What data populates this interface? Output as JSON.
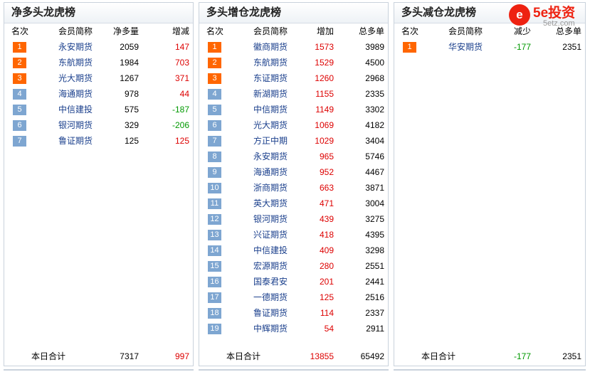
{
  "panel1": {
    "title": "净多头龙虎榜",
    "headers": [
      "名次",
      "会员简称",
      "净多量",
      "增减"
    ],
    "rows": [
      {
        "rank": "1",
        "name": "永安期货",
        "v1": "2059",
        "v2": "147",
        "v2_color": "red"
      },
      {
        "rank": "2",
        "name": "东航期货",
        "v1": "1984",
        "v2": "703",
        "v2_color": "red"
      },
      {
        "rank": "3",
        "name": "光大期货",
        "v1": "1267",
        "v2": "371",
        "v2_color": "red"
      },
      {
        "rank": "4",
        "name": "海通期货",
        "v1": "978",
        "v2": "44",
        "v2_color": "red"
      },
      {
        "rank": "5",
        "name": "中信建投",
        "v1": "575",
        "v2": "-187",
        "v2_color": "green"
      },
      {
        "rank": "6",
        "name": "银河期货",
        "v1": "329",
        "v2": "-206",
        "v2_color": "green"
      },
      {
        "rank": "7",
        "name": "鲁证期货",
        "v1": "125",
        "v2": "125",
        "v2_color": "red"
      }
    ],
    "footer": {
      "label": "本日合计",
      "v1": "7317",
      "v2": "997",
      "v2_color": "red"
    }
  },
  "panel2": {
    "title": "多头增仓龙虎榜",
    "headers": [
      "名次",
      "会员简称",
      "增加",
      "总多单"
    ],
    "rows": [
      {
        "rank": "1",
        "name": "徽商期货",
        "v1": "1573",
        "v2": "3989"
      },
      {
        "rank": "2",
        "name": "东航期货",
        "v1": "1529",
        "v2": "4500"
      },
      {
        "rank": "3",
        "name": "东证期货",
        "v1": "1260",
        "v2": "2968"
      },
      {
        "rank": "4",
        "name": "新湖期货",
        "v1": "1155",
        "v2": "2335"
      },
      {
        "rank": "5",
        "name": "中信期货",
        "v1": "1149",
        "v2": "3302"
      },
      {
        "rank": "6",
        "name": "光大期货",
        "v1": "1069",
        "v2": "4182"
      },
      {
        "rank": "7",
        "name": "方正中期",
        "v1": "1029",
        "v2": "3404"
      },
      {
        "rank": "8",
        "name": "永安期货",
        "v1": "965",
        "v2": "5746"
      },
      {
        "rank": "9",
        "name": "海通期货",
        "v1": "952",
        "v2": "4467"
      },
      {
        "rank": "10",
        "name": "浙商期货",
        "v1": "663",
        "v2": "3871"
      },
      {
        "rank": "11",
        "name": "英大期货",
        "v1": "471",
        "v2": "3004"
      },
      {
        "rank": "12",
        "name": "银河期货",
        "v1": "439",
        "v2": "3275"
      },
      {
        "rank": "13",
        "name": "兴证期货",
        "v1": "418",
        "v2": "4395"
      },
      {
        "rank": "14",
        "name": "中信建投",
        "v1": "409",
        "v2": "3298"
      },
      {
        "rank": "15",
        "name": "宏源期货",
        "v1": "280",
        "v2": "2551"
      },
      {
        "rank": "16",
        "name": "国泰君安",
        "v1": "201",
        "v2": "2441"
      },
      {
        "rank": "17",
        "name": "一德期货",
        "v1": "125",
        "v2": "2516"
      },
      {
        "rank": "18",
        "name": "鲁证期货",
        "v1": "114",
        "v2": "2337"
      },
      {
        "rank": "19",
        "name": "中辉期货",
        "v1": "54",
        "v2": "2911"
      }
    ],
    "footer": {
      "label": "本日合计",
      "v1": "13855",
      "v2": "65492"
    }
  },
  "panel3": {
    "title": "多头减仓龙虎榜",
    "headers": [
      "名次",
      "会员简称",
      "减少",
      "总多单"
    ],
    "rows": [
      {
        "rank": "1",
        "name": "华安期货",
        "v1": "-177",
        "v2": "2351"
      }
    ],
    "footer": {
      "label": "本日合计",
      "v1": "-177",
      "v2": "2351"
    }
  },
  "logo": {
    "mark": "e",
    "text": "5e投资",
    "sub": "5etz.com",
    "icon": "5e-logo-icon",
    "color": "#ee2211"
  },
  "colors": {
    "rank_hot": "#ff6600",
    "rank_cold": "#7ea6d1",
    "positive": "#dd0000",
    "negative": "#009900",
    "name_link": "#1a3f8c"
  }
}
